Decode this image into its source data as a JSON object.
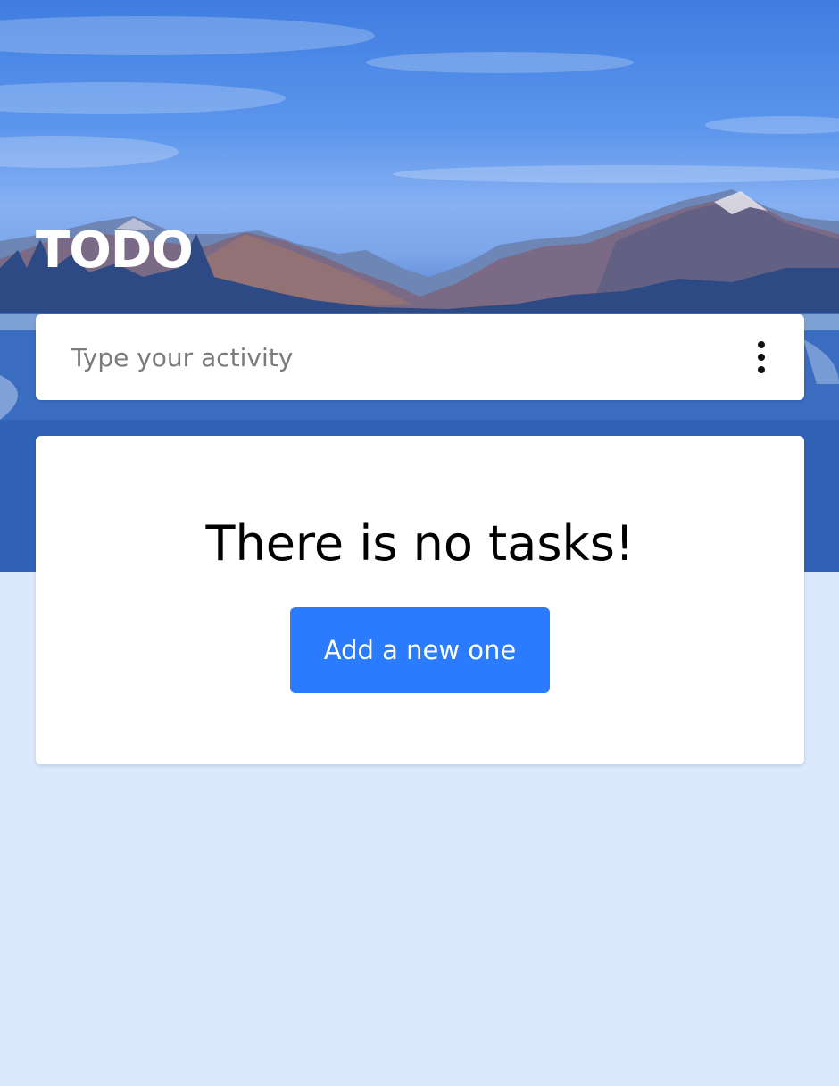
{
  "header": {
    "title": "TODO"
  },
  "input": {
    "placeholder": "Type your activity",
    "value": ""
  },
  "menu": {
    "icon": "more-vertical-icon"
  },
  "tasks": {
    "empty_message": "There is no tasks!",
    "add_button_label": "Add a new one",
    "items": []
  },
  "colors": {
    "accent": "#2b7bff",
    "page_background": "#dbe8fd",
    "card_background": "#ffffff"
  }
}
